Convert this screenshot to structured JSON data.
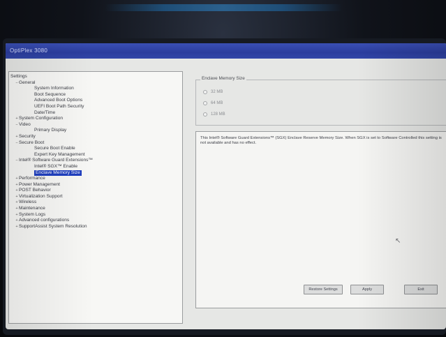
{
  "window": {
    "title": "OptiPlex 3080"
  },
  "tree": {
    "items": [
      {
        "label": "Settings",
        "level": 0,
        "expander": ""
      },
      {
        "label": "General",
        "level": 1,
        "expander": "−"
      },
      {
        "label": "System Information",
        "level": 2,
        "expander": ""
      },
      {
        "label": "Boot Sequence",
        "level": 2,
        "expander": ""
      },
      {
        "label": "Advanced Boot Options",
        "level": 2,
        "expander": ""
      },
      {
        "label": "UEFI Boot Path Security",
        "level": 2,
        "expander": ""
      },
      {
        "label": "Date/Time",
        "level": 2,
        "expander": ""
      },
      {
        "label": "System Configuration",
        "level": 1,
        "expander": "+"
      },
      {
        "label": "Video",
        "level": 1,
        "expander": "−"
      },
      {
        "label": "Primary Display",
        "level": 2,
        "expander": ""
      },
      {
        "label": "Security",
        "level": 1,
        "expander": "+"
      },
      {
        "label": "Secure Boot",
        "level": 1,
        "expander": "−"
      },
      {
        "label": "Secure Boot Enable",
        "level": 2,
        "expander": ""
      },
      {
        "label": "Expert Key Management",
        "level": 2,
        "expander": ""
      },
      {
        "label": "Intel® Software Guard Extensions™",
        "level": 1,
        "expander": "−"
      },
      {
        "label": "Intel® SGX™ Enable",
        "level": 2,
        "expander": ""
      },
      {
        "label": "Enclave Memory Size",
        "level": 2,
        "expander": "",
        "selected": true
      },
      {
        "label": "Performance",
        "level": 1,
        "expander": "+"
      },
      {
        "label": "Power Management",
        "level": 1,
        "expander": "+"
      },
      {
        "label": "POST Behavior",
        "level": 1,
        "expander": "+"
      },
      {
        "label": "Virtualization Support",
        "level": 1,
        "expander": "+"
      },
      {
        "label": "Wireless",
        "level": 1,
        "expander": "+"
      },
      {
        "label": "Maintenance",
        "level": 1,
        "expander": "+"
      },
      {
        "label": "System Logs",
        "level": 1,
        "expander": "+"
      },
      {
        "label": "Advanced configurations",
        "level": 1,
        "expander": "+"
      },
      {
        "label": "SupportAssist System Resolution",
        "level": 1,
        "expander": "+"
      }
    ]
  },
  "setting": {
    "group_title": "Enclave Memory Size",
    "options": [
      "32 MB",
      "64 MB",
      "128 MB"
    ],
    "description": "This Intel® Software Guard Extensions™ (SGX) Enclave Reserve Memory Size. When SGX is set to Software Controlled this setting is not available and has no effect."
  },
  "buttons": {
    "restore": "Restore Settings",
    "apply": "Apply",
    "exit": "Exit"
  },
  "cursor_glyph": "↖"
}
